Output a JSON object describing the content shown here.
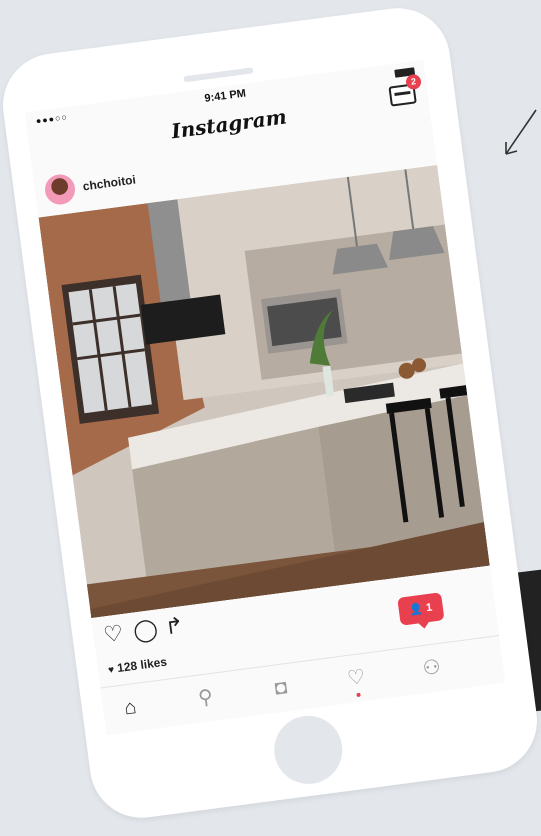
{
  "status_bar": {
    "signal": "●●●○○ ",
    "time": "9:41 PM"
  },
  "header": {
    "app_title": "Instagram",
    "inbox_badge": "2",
    "more_label": "..."
  },
  "post": {
    "username": "chchoitoi",
    "likes": "128 likes"
  },
  "notification": {
    "count": "1"
  },
  "icons": {
    "like": "heart-icon",
    "comment": "comment-icon",
    "share": "share-icon",
    "home": "home-icon",
    "search": "search-icon",
    "camera": "camera-icon",
    "activity": "heart-icon",
    "profile": "profile-icon"
  },
  "colors": {
    "accent": "#e8404f",
    "background": "#e3e7ec",
    "phone": "#ffffff"
  }
}
